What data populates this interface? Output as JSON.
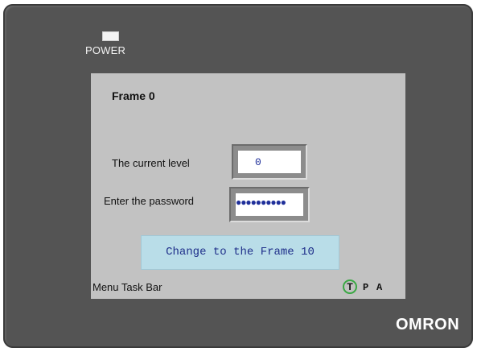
{
  "device": {
    "power_label": "POWER",
    "brand": "OMRON"
  },
  "screen": {
    "frame_title": "Frame 0",
    "current_level_label": "The current level",
    "current_level_value": "0",
    "password_label": "Enter the password",
    "password_value": "●●●●●●●●●●",
    "change_frame_button": "Change to the Frame 10",
    "taskbar_label": "Menu  Task Bar",
    "mode_t": "T",
    "mode_p": "P",
    "mode_a": "A"
  },
  "colors": {
    "bezel": "#545454",
    "screen_bg": "#c2c2c2",
    "button_bg": "#b9dde8",
    "button_text": "#1f2f8a",
    "mode_t_ring": "#39a843"
  }
}
